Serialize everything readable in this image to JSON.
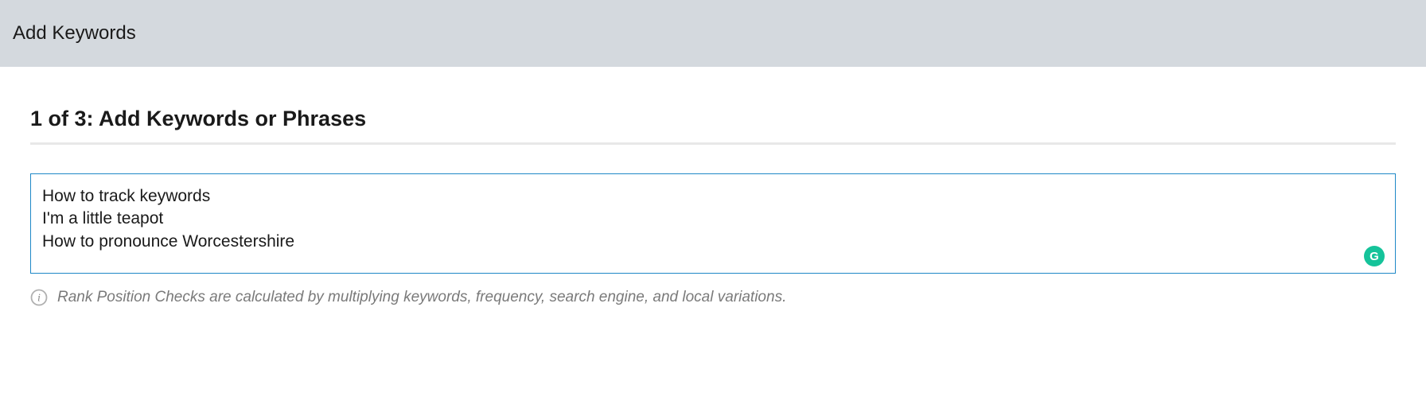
{
  "header": {
    "title": "Add Keywords"
  },
  "step": {
    "heading": "1 of 3: Add Keywords or Phrases"
  },
  "textarea": {
    "value": "How to track keywords\nI'm a little teapot\nHow to pronounce Worcestershire"
  },
  "badge": {
    "letter": "G"
  },
  "info": {
    "text": "Rank Position Checks are calculated by multiplying keywords, frequency, search engine, and local variations."
  }
}
